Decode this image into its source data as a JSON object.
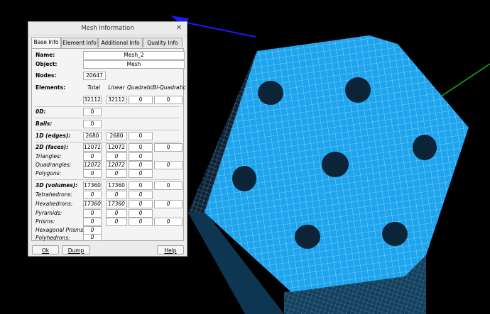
{
  "dialog": {
    "title": "Mesh Information",
    "close_glyph": "✕",
    "tabs": [
      "Base Info",
      "Element Info",
      "Additional Info",
      "Quality Info"
    ],
    "active_tab": "Base Info",
    "name_label": "Name:",
    "name_value": "Mesh_2",
    "object_label": "Object:",
    "object_value": "Mesh",
    "nodes_label": "Nodes:",
    "nodes_value": "20647",
    "elements_label": "Elements:",
    "columns": [
      "Total",
      "Linear",
      "Quadratic",
      "Bi-Quadratic"
    ],
    "elements_row": [
      "32112",
      "32112",
      "0",
      "0"
    ],
    "zero_d_label": "0D:",
    "zero_d_value": "0",
    "balls_label": "Balls:",
    "balls_value": "0",
    "edges_label": "1D (edges):",
    "edges_row": [
      "2680",
      "2680",
      "0"
    ],
    "faces_label": "2D (faces):",
    "faces_row": [
      "12072",
      "12072",
      "0",
      "0"
    ],
    "triangles_label": "Triangles:",
    "triangles_row": [
      "0",
      "0",
      "0"
    ],
    "quadrangles_label": "Quadrangles:",
    "quadrangles_row": [
      "12072",
      "12072",
      "0",
      "0"
    ],
    "polygons_label": "Polygons:",
    "polygons_row": [
      "0",
      "0",
      "0"
    ],
    "volumes_label": "3D (volumes):",
    "volumes_row": [
      "17360",
      "17360",
      "0",
      "0"
    ],
    "tetrahedrons_label": "Tetrahedrons:",
    "tetrahedrons_row": [
      "0",
      "0",
      "0"
    ],
    "hexahedrons_label": "Hexahedrons:",
    "hexahedrons_row": [
      "17360",
      "17360",
      "0",
      "0"
    ],
    "pyramids_label": "Pyramids:",
    "pyramids_row": [
      "0",
      "0",
      "0"
    ],
    "prisms_label": "Prisms:",
    "prisms_row": [
      "0",
      "0",
      "0",
      "0"
    ],
    "hex_prisms_label": "Hexagonal Prisms:",
    "hex_prisms_value": "0",
    "polyhedrons_label": "Polyhedrons:",
    "polyhedrons_value": "0",
    "ok_label": "Ok",
    "dump_label": "Dump",
    "help_label": "Help"
  },
  "colors": {
    "mesh_face": "#1ea5ee",
    "mesh_dark": "#0b2438",
    "axis_blue": "#1a1aff",
    "axis_green": "#13b213",
    "background": "#000000"
  }
}
